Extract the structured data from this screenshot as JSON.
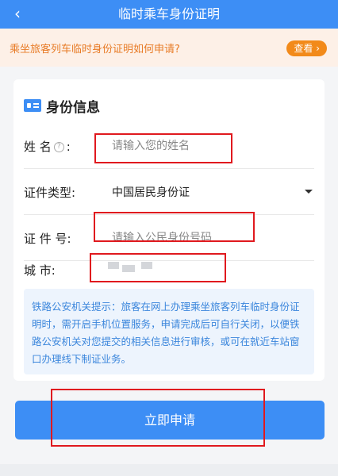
{
  "header": {
    "back_icon": "‹",
    "title": "临时乘车身份证明"
  },
  "notice": {
    "text": "乘坐旅客列车临时身份证明如何申请?",
    "button_label": "查看 ›"
  },
  "section": {
    "title": "身份信息"
  },
  "form": {
    "name_label": "姓  名",
    "name_colon": ":",
    "help_icon": "?",
    "name_placeholder": "请输入您的姓名",
    "idtype_label": "证件类型:",
    "idtype_value": "中国居民身份证",
    "idnum_label": "证 件 号:",
    "idnum_placeholder": "请输入公民身份号码",
    "city_label": "城      市:"
  },
  "tip": {
    "text": "铁路公安机关提示：旅客在网上办理乘坐旅客列车临时身份证明时，需开启手机位置服务，申请完成后可自行关闭，以便铁路公安机关对您提交的相关信息进行审核，或可在就近车站窗口办理线下制证业务。"
  },
  "submit": {
    "label": "立即申请"
  },
  "colors": {
    "primary": "#3d8ef5",
    "accent": "#f28a1a",
    "highlight": "#e0191e"
  }
}
